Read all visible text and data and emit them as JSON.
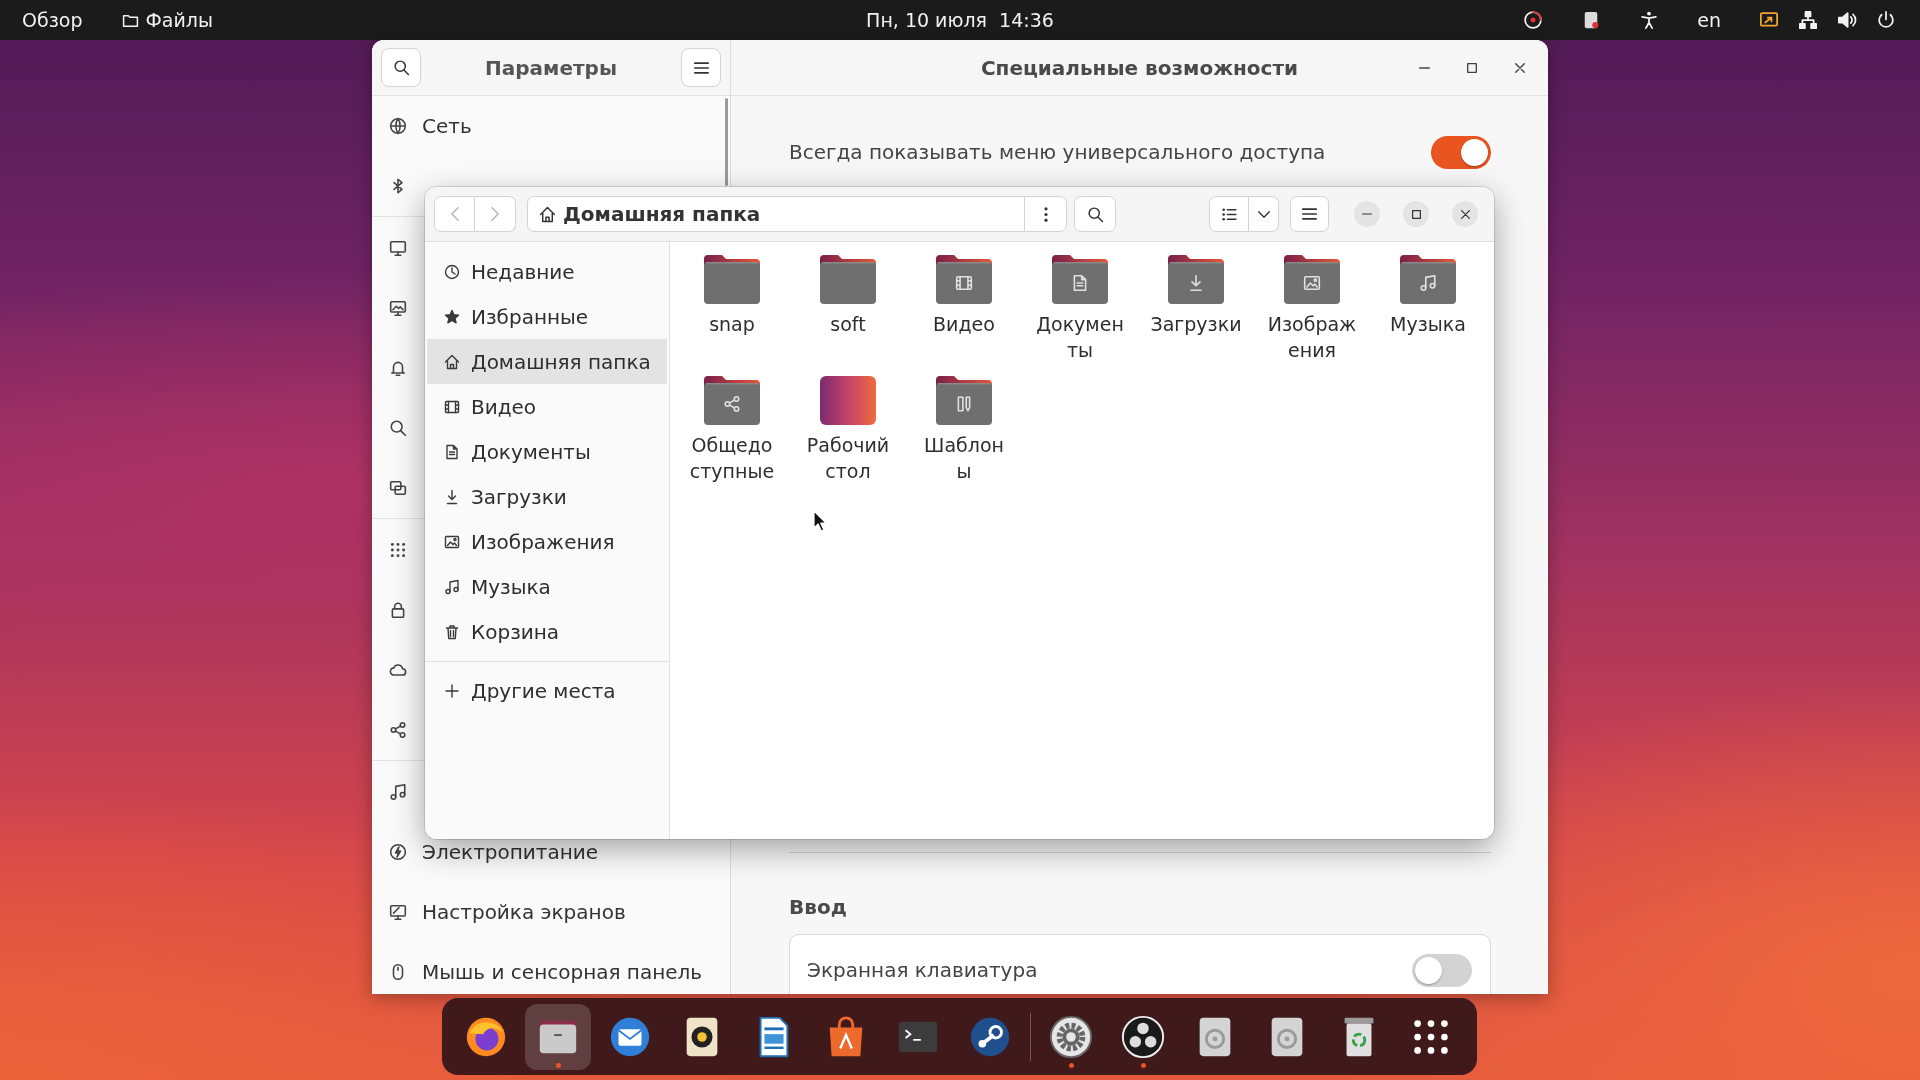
{
  "top_bar": {
    "activities": "Обзор",
    "app_menu": "Файлы",
    "clock": "Пн, 10 июля  14:36",
    "keyboard_layout": "en"
  },
  "settings_window": {
    "sidebar_title": "Параметры",
    "title": "Специальные возможности",
    "sidebar_groups": [
      {
        "items": [
          {
            "kind": "globe",
            "label": "Сеть"
          },
          {
            "kind": "bluetooth"
          }
        ]
      },
      {
        "items": [
          {
            "kind": "monitor"
          },
          {
            "kind": "monitor-picture"
          },
          {
            "kind": "bell"
          },
          {
            "kind": "magnifier"
          },
          {
            "kind": "windows"
          }
        ]
      },
      {
        "items": [
          {
            "kind": "dots"
          },
          {
            "kind": "lock"
          },
          {
            "kind": "cloud"
          },
          {
            "kind": "share"
          }
        ]
      },
      {
        "items": [
          {
            "kind": "note"
          },
          {
            "kind": "bolt",
            "label": "Электропитание"
          },
          {
            "kind": "display",
            "label": "Настройка экранов"
          },
          {
            "kind": "mouse",
            "label": "Мышь и сенсорная панель"
          }
        ]
      }
    ],
    "top_row": {
      "label": "Всегда показывать меню универсального доступа",
      "on": true
    },
    "sections": [
      {
        "heading": "Ввод",
        "rows": [
          {
            "label": "Экранная клавиатура",
            "on": false
          }
        ]
      }
    ]
  },
  "files_window": {
    "nav": [
      {
        "kind": "back",
        "disabled": true
      },
      {
        "kind": "forward",
        "disabled": true
      }
    ],
    "path": "Домашняя папка",
    "sidebar": [
      {
        "kind": "clock",
        "label": "Недавние",
        "selected": false
      },
      {
        "kind": "star",
        "label": "Избранные",
        "selected": false
      },
      {
        "kind": "home",
        "label": "Домашняя папка",
        "selected": true
      },
      {
        "kind": "film",
        "label": "Видео",
        "selected": false
      },
      {
        "kind": "document",
        "label": "Документы",
        "selected": false
      },
      {
        "kind": "download",
        "label": "Загрузки",
        "selected": false
      },
      {
        "kind": "image",
        "label": "Изображения",
        "selected": false
      },
      {
        "kind": "note",
        "label": "Музыка",
        "selected": false
      },
      {
        "kind": "trash",
        "label": "Корзина",
        "selected": false
      }
    ],
    "other_places": {
      "kind": "plus",
      "label": "Другие места"
    },
    "items": [
      {
        "kind": "folder",
        "label": "snap"
      },
      {
        "kind": "folder",
        "label": "soft"
      },
      {
        "kind": "film",
        "label": "Видео"
      },
      {
        "kind": "document",
        "label": "Докумен\nты"
      },
      {
        "kind": "download",
        "label": "Загрузки"
      },
      {
        "kind": "image",
        "label": "Изображ\nения"
      },
      {
        "kind": "note",
        "label": "Музыка"
      },
      {
        "kind": "share",
        "label": "Общедо\nступные"
      },
      {
        "kind": "desktop",
        "label": "Рабочий\nстол"
      },
      {
        "kind": "template",
        "label": "Шаблон\nы"
      }
    ]
  },
  "dock": [
    {
      "kind": "browser",
      "running": false,
      "selected": false
    },
    {
      "kind": "files",
      "running": true,
      "selected": true
    },
    {
      "kind": "mail",
      "running": false,
      "selected": false
    },
    {
      "kind": "player",
      "running": false,
      "selected": false
    },
    {
      "kind": "writer",
      "running": false,
      "selected": false
    },
    {
      "kind": "store",
      "running": false,
      "selected": false
    },
    {
      "kind": "terminal",
      "running": false,
      "selected": false
    },
    {
      "kind": "game",
      "running": false,
      "selected": false
    },
    {
      "kind": "separator"
    },
    {
      "kind": "settings",
      "running": true,
      "selected": false
    },
    {
      "kind": "recorder",
      "running": true,
      "selected": false
    },
    {
      "kind": "drive",
      "running": false,
      "selected": false
    },
    {
      "kind": "drive",
      "running": false,
      "selected": false
    },
    {
      "kind": "trash",
      "running": false,
      "selected": false
    },
    {
      "kind": "grid",
      "running": false,
      "selected": false
    }
  ]
}
